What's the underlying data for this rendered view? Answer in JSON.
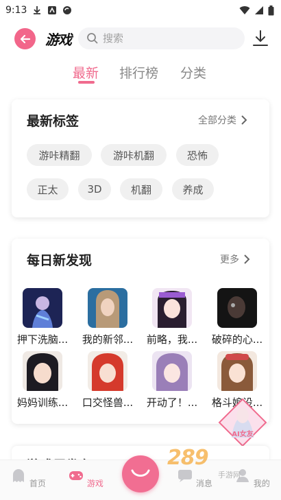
{
  "status_bar": {
    "time": "9:13"
  },
  "header": {
    "title": "游戏",
    "search_placeholder": "搜索"
  },
  "tabs": [
    {
      "label": "最新",
      "active": true
    },
    {
      "label": "排行榜",
      "active": false
    },
    {
      "label": "分类",
      "active": false
    }
  ],
  "tags_card": {
    "title": "最新标签",
    "more_label": "全部分类",
    "tags": [
      "游咔精翻",
      "游咔机翻",
      "恐怖",
      "正太",
      "3D",
      "机翻",
      "养成"
    ]
  },
  "discover_card": {
    "title": "每日新发现",
    "more_label": "更多",
    "games": [
      {
        "name": "押下洗脑..."
      },
      {
        "name": "我的新邻..."
      },
      {
        "name": "前略，我..."
      },
      {
        "name": "破碎的心..."
      },
      {
        "name": "妈妈训练..."
      },
      {
        "name": "口交怪兽..."
      },
      {
        "name": "开动了！..."
      },
      {
        "name": "格斗娘设..."
      }
    ]
  },
  "next_card": {
    "title": "游戏巨发布"
  },
  "bottom_nav": {
    "items": [
      {
        "label": "首页",
        "active": false
      },
      {
        "label": "游戏",
        "active": true
      },
      {
        "label": "消息",
        "active": false
      },
      {
        "label": "我的",
        "active": false
      }
    ]
  },
  "badge": {
    "label": "AI女友"
  },
  "watermark": {
    "text": "289",
    "sub": "手游网"
  },
  "colors": {
    "accent": "#f06b8e",
    "tag_bg": "#f0f0f0"
  }
}
